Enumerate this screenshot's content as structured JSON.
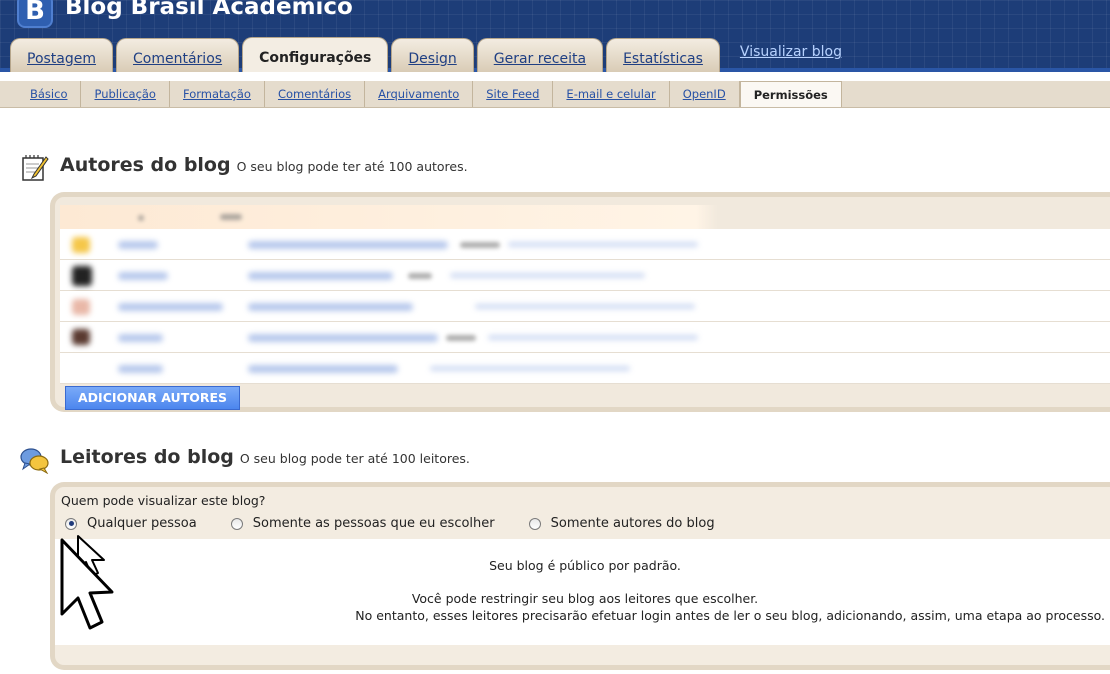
{
  "header": {
    "blog_title": "Blog Brasil Acadêmico",
    "logo_icon": "blogger-logo-icon",
    "tabs": [
      {
        "label": "Postagem",
        "active": false
      },
      {
        "label": "Comentários",
        "active": false
      },
      {
        "label": "Configurações",
        "active": true
      },
      {
        "label": "Design",
        "active": false
      },
      {
        "label": "Gerar receita",
        "active": false
      },
      {
        "label": "Estatísticas",
        "active": false
      }
    ],
    "view_blog_label": "Visualizar blog"
  },
  "subnav": {
    "tabs": [
      {
        "label": "Básico",
        "active": false
      },
      {
        "label": "Publicação",
        "active": false
      },
      {
        "label": "Formatação",
        "active": false
      },
      {
        "label": "Comentários",
        "active": false
      },
      {
        "label": "Arquivamento",
        "active": false
      },
      {
        "label": "Site Feed",
        "active": false
      },
      {
        "label": "E-mail e celular",
        "active": false
      },
      {
        "label": "OpenID",
        "active": false
      },
      {
        "label": "Permissões",
        "active": true
      }
    ]
  },
  "authors": {
    "title": "Autores do blog",
    "subtitle": "O seu blog pode ter até 100 autores.",
    "icon": "notepad-pencil-icon",
    "add_button_label": "ADICIONAR AUTORES"
  },
  "readers": {
    "title": "Leitores do blog",
    "subtitle": "O seu blog pode ter até 100 leitores.",
    "icon": "chat-bubbles-icon",
    "question": "Quem pode visualizar este blog?",
    "options": [
      {
        "label": "Qualquer pessoa",
        "checked": true
      },
      {
        "label": "Somente as pessoas que eu escolher",
        "checked": false
      },
      {
        "label": "Somente autores do blog",
        "checked": false
      }
    ],
    "message_public": "Seu blog é público por padrão.",
    "message_restrict_1": "Você pode restringir seu blog aos leitores que escolher.",
    "message_restrict_2": "No entanto, esses leitores precisarão efetuar login antes de ler o seu blog, adicionando, assim, uma etapa ao processo."
  },
  "colors": {
    "header_bg": "#1d3d78",
    "tab_bg": "#e5dccd",
    "link": "#2751a5",
    "button_blue": "#4c86ee"
  }
}
